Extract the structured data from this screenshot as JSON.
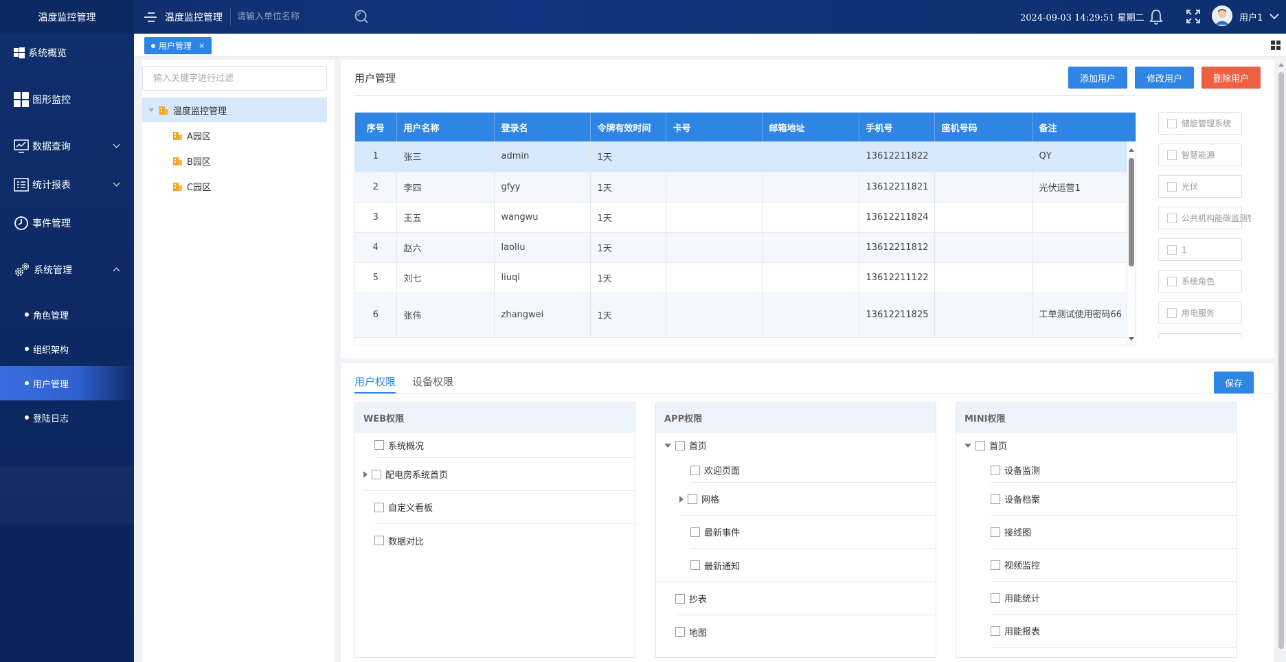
{
  "app": {
    "brand": "温度监控管理",
    "header_title": "温度监控管理",
    "search_placeholder": "请输入单位名称",
    "datetime": "2024-09-03 14:29:51 星期二",
    "username": "用户1"
  },
  "sidebar": {
    "items": [
      {
        "label": "系统概览",
        "icon": "windows-icon"
      },
      {
        "label": "图形监控",
        "icon": "grid-tiles-icon"
      },
      {
        "label": "数据查询",
        "icon": "monitor-chart-icon"
      },
      {
        "label": "统计报表",
        "icon": "report-icon"
      },
      {
        "label": "事件管理",
        "icon": "clock-icon"
      },
      {
        "label": "系统管理",
        "icon": "gears-icon"
      }
    ],
    "sub_items": [
      {
        "label": "角色管理"
      },
      {
        "label": "组织架构"
      },
      {
        "label": "用户管理",
        "active": true
      },
      {
        "label": "登陆日志"
      }
    ]
  },
  "tabs": [
    {
      "label": "用户管理",
      "close": "×"
    }
  ],
  "tree": {
    "filter_placeholder": "输入关键字进行过滤",
    "root": "温度监控管理",
    "children": [
      "A园区",
      "B园区",
      "C园区"
    ]
  },
  "user_panel": {
    "title": "用户管理",
    "buttons": {
      "add": "添加用户",
      "edit": "修改用户",
      "delete": "删除用户"
    },
    "columns": [
      "序号",
      "用户名称",
      "登录名",
      "令牌有效时间",
      "卡号",
      "邮箱地址",
      "手机号",
      "座机号码",
      "备注"
    ],
    "rows": [
      [
        "1",
        "张三",
        "admin",
        "1天",
        "",
        "",
        "13612211822",
        "",
        "QY"
      ],
      [
        "2",
        "李四",
        "gfyy",
        "1天",
        "",
        "",
        "13612211821",
        "",
        "光伏运营1"
      ],
      [
        "3",
        "王五",
        "wangwu",
        "1天",
        "",
        "",
        "13612211824",
        "",
        ""
      ],
      [
        "4",
        "赵六",
        "laoliu",
        "1天",
        "",
        "",
        "13612211812",
        "",
        ""
      ],
      [
        "5",
        "刘七",
        "liuqi",
        "1天",
        "",
        "",
        "13612211122",
        "",
        ""
      ],
      [
        "6",
        "张伟",
        "zhangwei",
        "1天",
        "",
        "",
        "13612211825",
        "",
        "工单测试使用密码66"
      ]
    ],
    "roles": [
      "储能管理系统",
      "智慧能源",
      "光伏",
      "公共机构能碳监测管理",
      "1",
      "系统角色",
      "用电服务"
    ]
  },
  "permissions": {
    "tabs": [
      "用户权限",
      "设备权限"
    ],
    "save": "保存",
    "web": {
      "title": "WEB权限",
      "items": [
        "系统概况",
        "配电房系统首页",
        "自定义看板",
        "数据对比"
      ]
    },
    "app": {
      "title": "APP权限",
      "root": "首页",
      "children": [
        "欢迎页面",
        "网格",
        "最新事件",
        "最新通知"
      ],
      "others": [
        "抄表",
        "地图"
      ]
    },
    "mini": {
      "title": "MINI权限",
      "root": "首页",
      "children": [
        "设备监测",
        "设备档案",
        "接线图",
        "视频监控",
        "用能统计",
        "用能报表"
      ]
    }
  },
  "colors": {
    "accent": "#2e85e4",
    "danger": "#ef5f44",
    "sidebar": "#0f2e6c"
  }
}
